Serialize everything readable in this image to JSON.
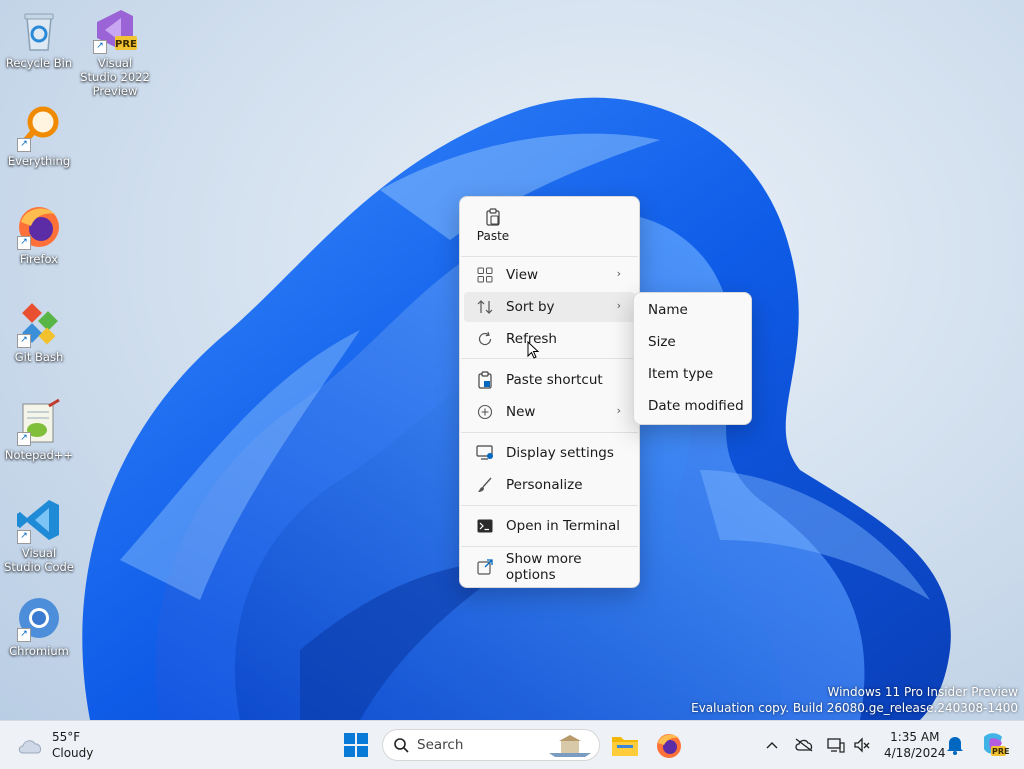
{
  "desktop": {
    "icons": [
      {
        "label": "Recycle Bin",
        "icon": "recycle-bin-icon"
      },
      {
        "label": "Visual Studio 2022 Preview",
        "icon": "visual-studio-icon",
        "badge": "PRE"
      },
      {
        "label": "Everything",
        "icon": "everything-search-icon"
      },
      {
        "label": "Firefox",
        "icon": "firefox-icon"
      },
      {
        "label": "Git Bash",
        "icon": "git-bash-icon"
      },
      {
        "label": "Notepad++",
        "icon": "notepad-plus-plus-icon"
      },
      {
        "label": "Visual Studio Code",
        "icon": "vscode-icon"
      },
      {
        "label": "Chromium",
        "icon": "chromium-icon"
      }
    ],
    "watermark": {
      "line1": "Windows 11 Pro Insider Preview",
      "line2": "Evaluation copy. Build 26080.ge_release.240308-1400"
    }
  },
  "context_menu": {
    "paste": "Paste",
    "items": [
      {
        "label": "View",
        "icon": "grid-view-icon",
        "submenu": true
      },
      {
        "label": "Sort by",
        "icon": "sort-icon",
        "submenu": true
      },
      {
        "label": "Refresh",
        "icon": "refresh-icon"
      },
      {
        "label": "Paste shortcut",
        "icon": "paste-shortcut-icon"
      },
      {
        "label": "New",
        "icon": "new-plus-icon",
        "submenu": true
      },
      {
        "label": "Display settings",
        "icon": "display-settings-icon"
      },
      {
        "label": "Personalize",
        "icon": "brush-icon"
      },
      {
        "label": "Open in Terminal",
        "icon": "terminal-icon"
      },
      {
        "label": "Show more options",
        "icon": "more-options-icon"
      }
    ],
    "chevron": "›"
  },
  "sort_submenu": {
    "items": [
      "Name",
      "Size",
      "Item type",
      "Date modified"
    ]
  },
  "taskbar": {
    "weather": {
      "temp": "55°F",
      "condition": "Cloudy"
    },
    "search_placeholder": "Search",
    "clock": {
      "time": "1:35 AM",
      "date": "4/18/2024"
    },
    "copilot_badge": "PRE"
  },
  "colors": {
    "accent": "#0067c0",
    "wallpaper_blue": "#1464f0",
    "menu_bg": "#f9f9f9",
    "taskbar_bg": "#eef1f6"
  }
}
